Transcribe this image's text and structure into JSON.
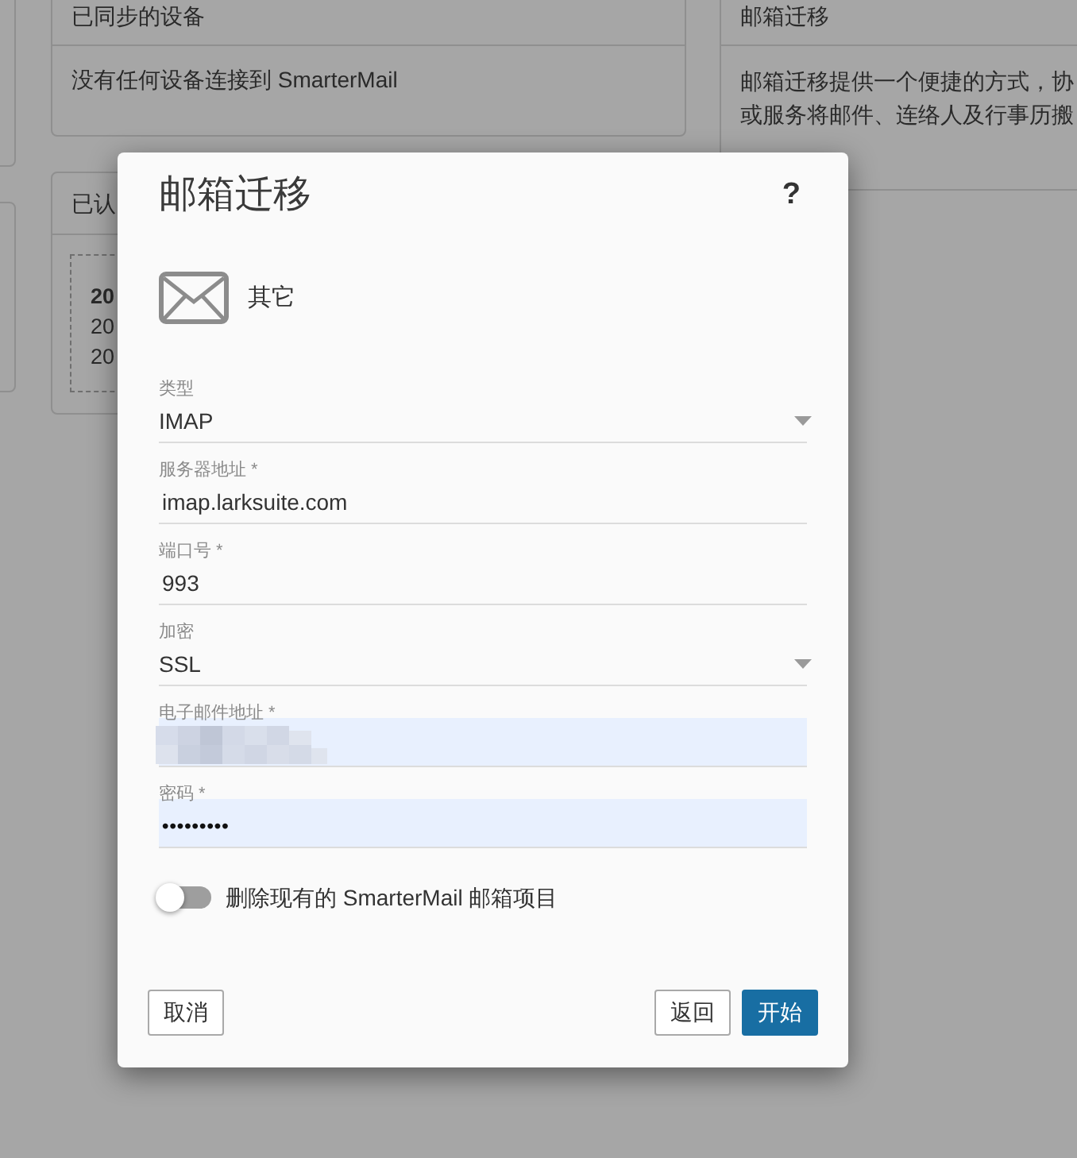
{
  "background": {
    "synced_devices": {
      "title": "已同步的设备",
      "message": "没有任何设备连接到 SmarterMail"
    },
    "authenticated": {
      "title": "已认",
      "lines": [
        {
          "text": "20",
          "kind": "heading"
        },
        {
          "text": "20",
          "kind": "detail"
        },
        {
          "text": "20",
          "kind": "detail"
        }
      ]
    },
    "migration": {
      "title": "邮箱迁移",
      "description": [
        "邮箱迁移提供一个便捷的方式，协",
        "或服务将邮件、连络人及行事历搬"
      ]
    }
  },
  "dialog": {
    "title": "邮箱迁移",
    "help": "?",
    "provider": {
      "name": "其它"
    },
    "fields": [
      {
        "kind": "select",
        "label": "类型",
        "value": "IMAP",
        "autofilled": false,
        "redacted": false
      },
      {
        "kind": "text",
        "label": "服务器地址 *",
        "value": "imap.larksuite.com",
        "autofilled": false,
        "redacted": false
      },
      {
        "kind": "text",
        "label": "端口号 *",
        "value": "993",
        "autofilled": false,
        "redacted": false
      },
      {
        "kind": "select",
        "label": "加密",
        "value": "SSL",
        "autofilled": false,
        "redacted": false
      },
      {
        "kind": "text",
        "label": "电子邮件地址 *",
        "autofilled": true,
        "redacted": true
      },
      {
        "kind": "password",
        "label": "密码 *",
        "value": "•••••••••",
        "autofilled": true,
        "redacted": false
      }
    ],
    "toggle": {
      "label": "删除现有的 SmarterMail 邮箱项目",
      "on": false
    },
    "buttons": [
      {
        "label": "取消",
        "kind": "secondary"
      },
      {
        "label": "返回",
        "kind": "secondary"
      },
      {
        "label": "开始",
        "kind": "primary"
      }
    ]
  }
}
